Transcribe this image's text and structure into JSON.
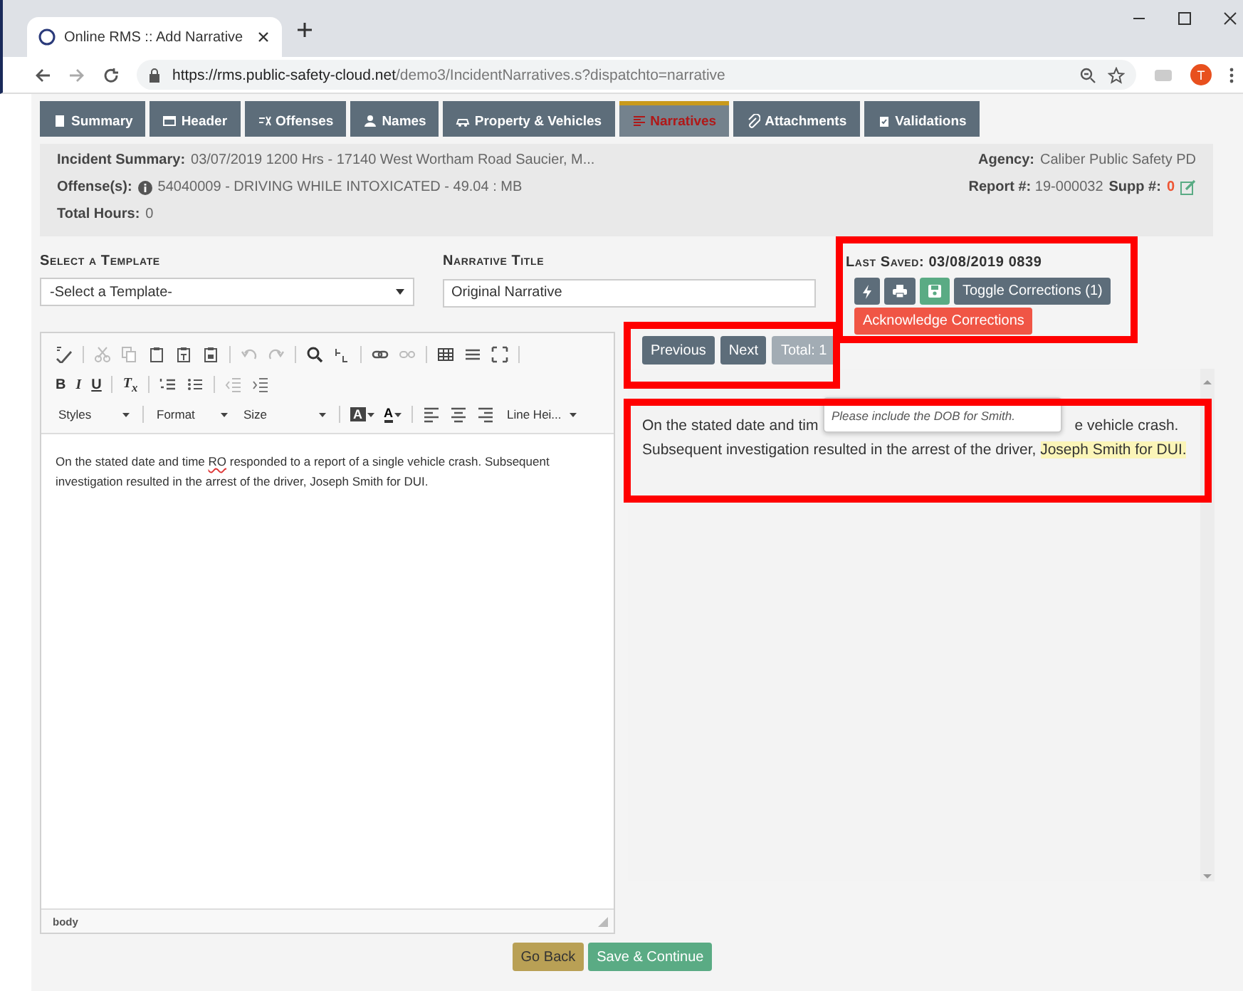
{
  "browser": {
    "tab_title": "Online RMS :: Add Narrative",
    "url_host": "https://rms.public-safety-cloud.net",
    "url_path": "/demo3/IncidentNarratives.s?dispatchto=narrative",
    "profile_initial": "T"
  },
  "nav_tabs": [
    {
      "label": "Summary",
      "selected": false
    },
    {
      "label": "Header",
      "selected": false
    },
    {
      "label": "Offenses",
      "selected": false
    },
    {
      "label": "Names",
      "selected": false
    },
    {
      "label": "Property & Vehicles",
      "selected": false
    },
    {
      "label": "Narratives",
      "selected": true
    },
    {
      "label": "Attachments",
      "selected": false
    },
    {
      "label": "Validations",
      "selected": false
    }
  ],
  "summary": {
    "incident_label": "Incident Summary:",
    "incident_value": "03/07/2019 1200 Hrs - 17140 West Wortham Road Saucier, M...",
    "offense_label": "Offense(s):",
    "offense_value": "54040009 - DRIVING WHILE INTOXICATED - 49.04 : MB",
    "hours_label": "Total Hours:",
    "hours_value": "0",
    "agency_label": "Agency:",
    "agency_value": "Caliber Public Safety PD",
    "report_label": "Report #:",
    "report_value": "19-000032",
    "supp_label": "Supp #:",
    "supp_value": "0"
  },
  "template": {
    "label": "Select a Template",
    "value": "-Select a Template-"
  },
  "title_field": {
    "label": "Narrative Title",
    "value": "Original Narrative"
  },
  "last_saved": {
    "label": "Last Saved:",
    "value": "03/08/2019 0839"
  },
  "toggle_button": "Toggle Corrections (1)",
  "acknowledge_button": "Acknowledge Corrections",
  "pager": {
    "previous": "Previous",
    "next": "Next",
    "total": "Total: 1"
  },
  "editor": {
    "format_buttons": [
      "B",
      "I",
      "U"
    ],
    "clear_format": "T$_{x}$",
    "dropdowns": [
      "Styles",
      "Format",
      "Size"
    ],
    "bg_color": "A",
    "text_color": "A",
    "line_height": "Line Hei...",
    "text_before": "On the stated date and time ",
    "misspelled": "RO",
    "text_after": " responded to a report of a single vehicle crash. Subsequent investigation resulted in the arrest of the driver, Joseph Smith for DUI.",
    "path": "body"
  },
  "correction_view": {
    "line1_start": "On the stated date and tim",
    "line1_end": "e vehicle crash.",
    "line2": "Subsequent investigation resulted in the arrest of the driver, ",
    "highlight": "Joseph Smith for DUI.",
    "tooltip": "Please include the DOB for Smith."
  },
  "footer": {
    "back": "Go Back",
    "continue": "Save & Continue"
  }
}
